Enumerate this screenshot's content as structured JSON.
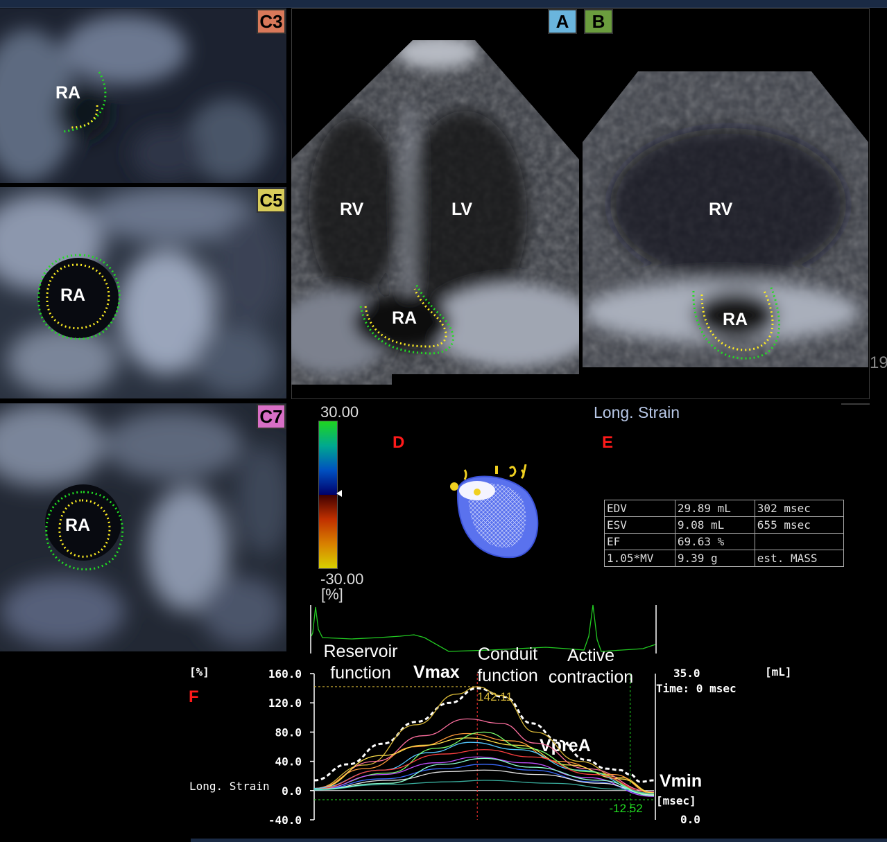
{
  "views": {
    "c3": {
      "badge": "C3",
      "badge_color": "#d9795a",
      "label": "RA"
    },
    "c5": {
      "badge": "C5",
      "badge_color": "#d8cc5a",
      "label": "RA"
    },
    "c7": {
      "badge": "C7",
      "badge_color": "#d86fc6",
      "label": "RA"
    },
    "a": {
      "badge": "A",
      "badge_color": "#6ab5dd",
      "labels": {
        "rv": "RV",
        "lv": "LV",
        "ra": "RA"
      }
    },
    "b": {
      "badge": "B",
      "badge_color": "#6b9d3e",
      "labels": {
        "rv": "RV",
        "ra": "RA"
      },
      "edge_text": "19"
    }
  },
  "colorbar": {
    "max": "30.00",
    "min": "-30.00",
    "unit": "[%]"
  },
  "panel_d": {
    "letter": "D"
  },
  "panel_e": {
    "letter": "E",
    "title": "Long. Strain"
  },
  "stats": [
    [
      "EDV",
      "29.89 mL",
      "302 msec"
    ],
    [
      "ESV",
      "9.08 mL",
      "655 msec"
    ],
    [
      "EF",
      "69.63 %",
      ""
    ],
    [
      "1.05*MV",
      "9.39 g",
      "est. MASS"
    ]
  ],
  "phases": {
    "reservoir": "Reservoir\nfunction",
    "conduit": "Conduit\nfunction",
    "active": "Active\ncontraction",
    "vmax": "Vmax",
    "vprea": "VpreA",
    "vmin": "Vmin"
  },
  "panel_f": {
    "letter": "F",
    "left_unit": "[%]",
    "right_unit": "[mL]",
    "row_label": "Long. Strain",
    "right_top": "35.0",
    "time": "Time: 0 msec",
    "right_unit_bottom": "[msec]",
    "right_bottom": "0.0"
  },
  "chart_data": {
    "type": "line",
    "ylabel": "[%]",
    "ylim": [
      -40,
      160
    ],
    "yticks": [
      "160.0",
      "120.0",
      "80.0",
      "40.0",
      "0.0",
      "-40.0"
    ],
    "y2label": "[mL]",
    "annotations": [
      {
        "text": "142.11",
        "x": 0.48,
        "y": 142.11
      },
      {
        "text": "-12.52",
        "x": 0.95,
        "y": -12.52
      }
    ],
    "series": [
      {
        "color": "#ffffff",
        "dashed": true,
        "values": [
          [
            0,
            14
          ],
          [
            0.1,
            36
          ],
          [
            0.2,
            64
          ],
          [
            0.3,
            94
          ],
          [
            0.4,
            120
          ],
          [
            0.48,
            140
          ],
          [
            0.56,
            128
          ],
          [
            0.64,
            92
          ],
          [
            0.72,
            68
          ],
          [
            0.8,
            42
          ],
          [
            0.86,
            30
          ],
          [
            0.9,
            28
          ],
          [
            0.93,
            22
          ],
          [
            0.96,
            12
          ],
          [
            1,
            14
          ]
        ]
      },
      {
        "color": "#d8b838",
        "values": [
          [
            0,
            3
          ],
          [
            0.15,
            35
          ],
          [
            0.3,
            90
          ],
          [
            0.42,
            132
          ],
          [
            0.48,
            142
          ],
          [
            0.55,
            130
          ],
          [
            0.65,
            80
          ],
          [
            0.78,
            40
          ],
          [
            0.9,
            18
          ],
          [
            1,
            -3
          ]
        ]
      },
      {
        "color": "#ff6fa0",
        "values": [
          [
            0,
            3
          ],
          [
            0.18,
            40
          ],
          [
            0.32,
            75
          ],
          [
            0.45,
            98
          ],
          [
            0.55,
            92
          ],
          [
            0.65,
            65
          ],
          [
            0.8,
            30
          ],
          [
            1,
            -2
          ]
        ]
      },
      {
        "color": "#ff9a3a",
        "values": [
          [
            0,
            2
          ],
          [
            0.15,
            30
          ],
          [
            0.3,
            60
          ],
          [
            0.45,
            78
          ],
          [
            0.58,
            68
          ],
          [
            0.72,
            40
          ],
          [
            0.88,
            22
          ],
          [
            1,
            -4
          ]
        ]
      },
      {
        "color": "#ffe14a",
        "values": [
          [
            0,
            2
          ],
          [
            0.2,
            48
          ],
          [
            0.32,
            62
          ],
          [
            0.45,
            72
          ],
          [
            0.6,
            62
          ],
          [
            0.75,
            35
          ],
          [
            0.9,
            16
          ],
          [
            1,
            -3
          ]
        ]
      },
      {
        "color": "#54c8ff",
        "values": [
          [
            0,
            3
          ],
          [
            0.2,
            28
          ],
          [
            0.34,
            52
          ],
          [
            0.46,
            66
          ],
          [
            0.6,
            56
          ],
          [
            0.78,
            28
          ],
          [
            1,
            -6
          ]
        ]
      },
      {
        "color": "#7cff6a",
        "values": [
          [
            0,
            2
          ],
          [
            0.22,
            24
          ],
          [
            0.36,
            58
          ],
          [
            0.5,
            80
          ],
          [
            0.62,
            58
          ],
          [
            0.8,
            26
          ],
          [
            1,
            -5
          ]
        ]
      },
      {
        "color": "#c050ff",
        "values": [
          [
            0,
            1
          ],
          [
            0.2,
            22
          ],
          [
            0.36,
            38
          ],
          [
            0.48,
            46
          ],
          [
            0.62,
            38
          ],
          [
            0.8,
            18
          ],
          [
            1,
            -8
          ]
        ]
      },
      {
        "color": "#3a6cff",
        "values": [
          [
            0,
            1
          ],
          [
            0.2,
            16
          ],
          [
            0.38,
            30
          ],
          [
            0.5,
            36
          ],
          [
            0.64,
            28
          ],
          [
            0.82,
            12
          ],
          [
            1,
            -6
          ]
        ]
      },
      {
        "color": "#ff4040",
        "values": [
          [
            0,
            2
          ],
          [
            0.2,
            28
          ],
          [
            0.38,
            50
          ],
          [
            0.5,
            56
          ],
          [
            0.64,
            46
          ],
          [
            0.82,
            22
          ],
          [
            1,
            -4
          ]
        ]
      },
      {
        "color": "#e6e6e6",
        "values": [
          [
            0,
            1
          ],
          [
            0.22,
            14
          ],
          [
            0.4,
            26
          ],
          [
            0.5,
            28
          ],
          [
            0.66,
            22
          ],
          [
            0.84,
            10
          ],
          [
            1,
            -6
          ]
        ]
      },
      {
        "color": "#3ab0a0",
        "values": [
          [
            0,
            1
          ],
          [
            0.2,
            8
          ],
          [
            0.4,
            12
          ],
          [
            0.5,
            14
          ],
          [
            0.7,
            10
          ],
          [
            0.9,
            2
          ],
          [
            1,
            -4
          ]
        ]
      },
      {
        "color": "#8affd0",
        "values": [
          [
            0,
            2
          ],
          [
            0.22,
            10
          ],
          [
            0.38,
            36
          ],
          [
            0.5,
            44
          ],
          [
            0.64,
            32
          ],
          [
            0.84,
            14
          ],
          [
            1,
            -7
          ]
        ]
      }
    ]
  }
}
